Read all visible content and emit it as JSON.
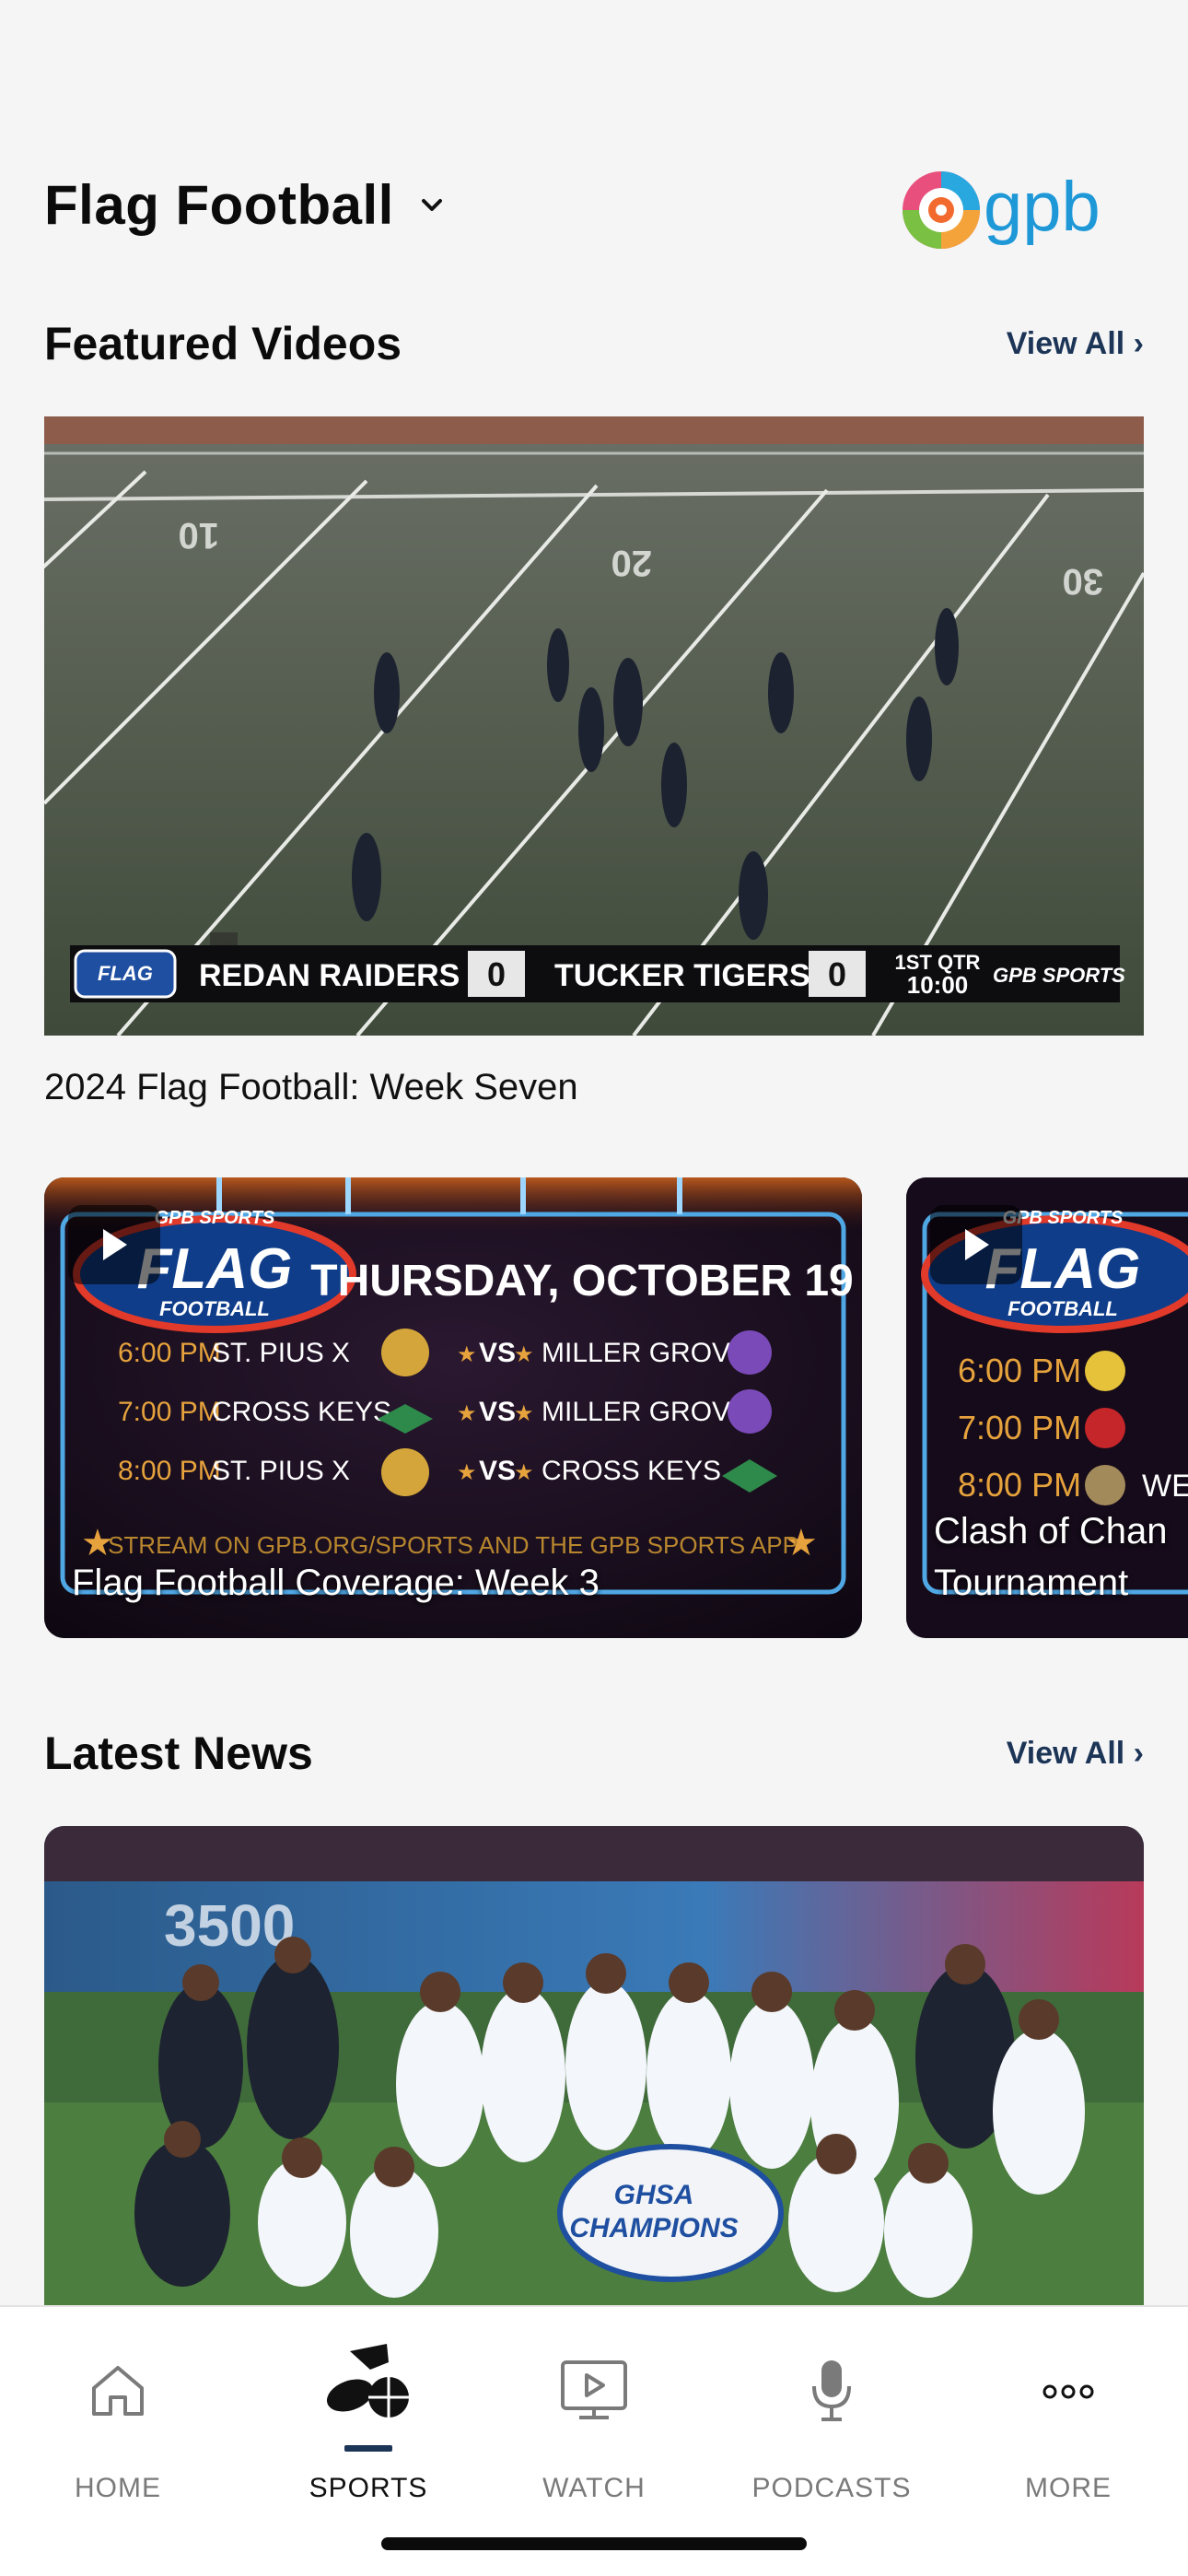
{
  "header": {
    "title": "Flag Football",
    "logo_text": "gpb"
  },
  "featured": {
    "title": "Featured Videos",
    "view_all": "View All ›",
    "hero": {
      "caption": "2024 Flag Football: Week Seven",
      "scoreboard": {
        "badge": "FLAG",
        "team1": "REDAN RAIDERS",
        "score1": "0",
        "team2": "TUCKER TIGERS",
        "score2": "0",
        "quarter": "1ST QTR",
        "clock": "10:00",
        "brand": "GPB SPORTS"
      }
    },
    "cards": [
      {
        "caption": "Flag Football Coverage: Week 3",
        "graphic": {
          "logo_top": "GPB SPORTS",
          "logo_main": "FLAG",
          "logo_sub": "FOOTBALL",
          "date": "THURSDAY, OCTOBER 19",
          "games": [
            {
              "time": "6:00 PM",
              "home": "ST. PIUS X",
              "vs": "VS",
              "away": "MILLER GROVE"
            },
            {
              "time": "7:00 PM",
              "home": "CROSS KEYS",
              "vs": "VS",
              "away": "MILLER GROVE"
            },
            {
              "time": "8:00 PM",
              "home": "ST. PIUS X",
              "vs": "VS",
              "away": "CROSS KEYS"
            }
          ],
          "footer": "STREAM ON GPB.ORG/SPORTS AND THE GPB SPORTS APP"
        }
      },
      {
        "caption_line1": "Clash of Chan",
        "caption_line2": "Tournament",
        "graphic": {
          "logo_top": "GPB SPORTS",
          "logo_main": "FLAG",
          "logo_sub": "FOOTBALL",
          "times": [
            "6:00 PM",
            "7:00 PM",
            "8:00 PM"
          ],
          "partial": "WES"
        }
      }
    ]
  },
  "news": {
    "title": "Latest News",
    "view_all": "View All ›",
    "image_text": {
      "stadium": "3500",
      "banner_top": "GHSA",
      "banner_main": "CHAMPIONS"
    }
  },
  "tabs": [
    {
      "label": "HOME",
      "icon": "home-icon",
      "active": false
    },
    {
      "label": "SPORTS",
      "icon": "sports-icon",
      "active": true
    },
    {
      "label": "WATCH",
      "icon": "watch-icon",
      "active": false
    },
    {
      "label": "PODCASTS",
      "icon": "microphone-icon",
      "active": false
    },
    {
      "label": "MORE",
      "icon": "more-icon",
      "active": false
    }
  ],
  "colors": {
    "accent": "#1c3557",
    "background": "#f5f5f6",
    "gold": "#e6a23c"
  }
}
